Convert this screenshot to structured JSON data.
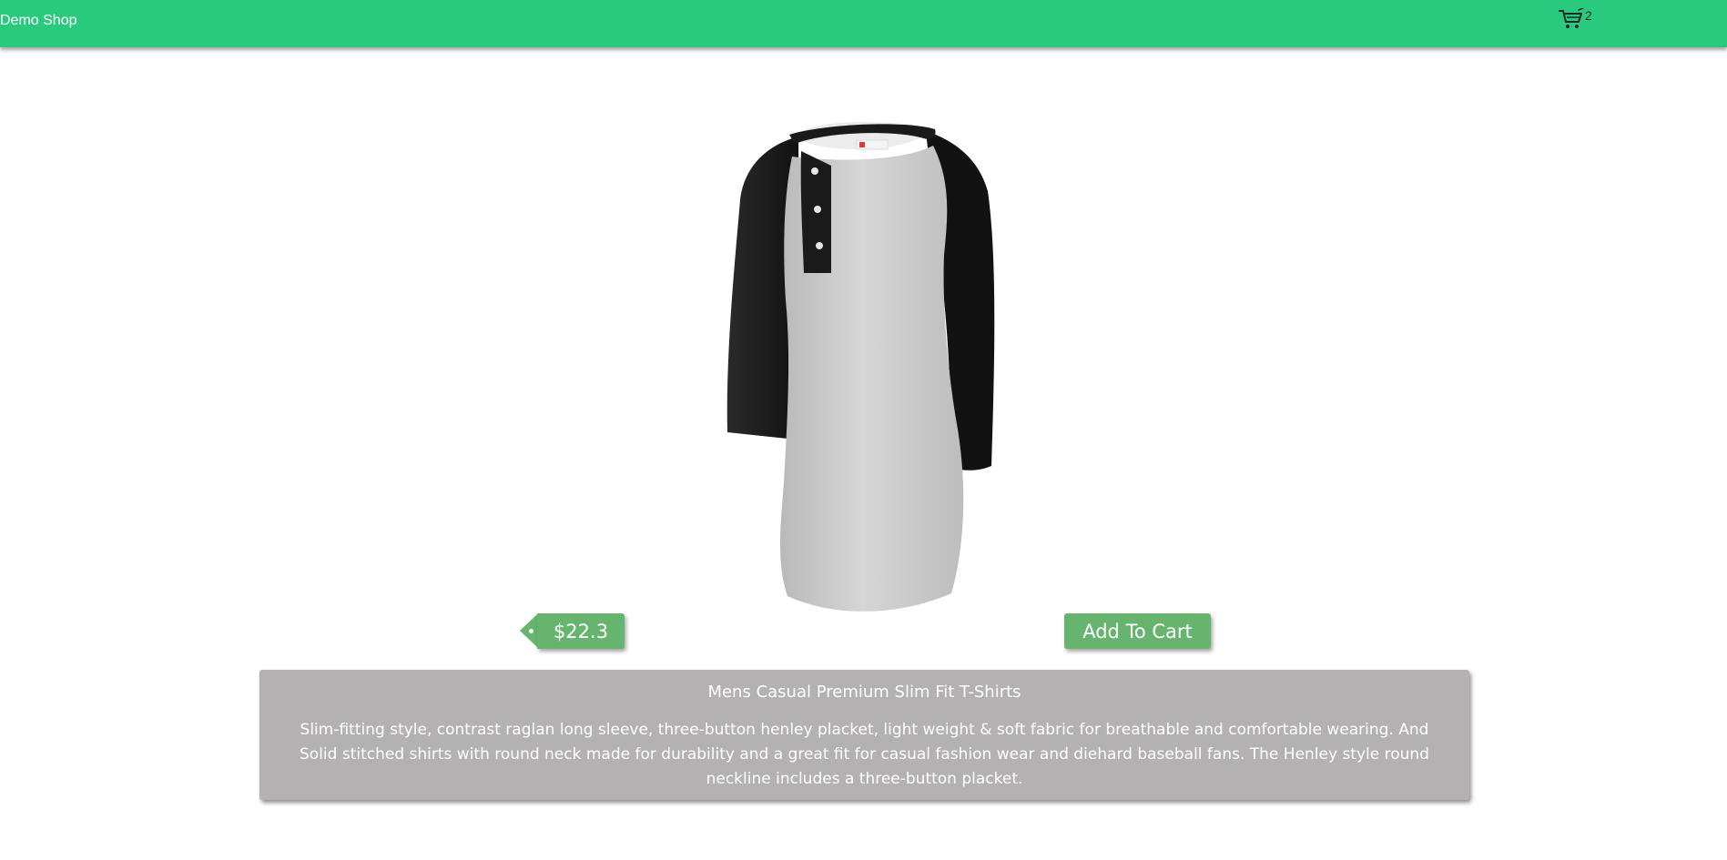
{
  "header": {
    "brand": "Demo Shop",
    "cart_icon": "shopping-cart-icon",
    "cart_count": "2",
    "color": "#29c97e"
  },
  "product": {
    "image": "raglan-henley-tshirt-image",
    "price": "$22.3",
    "add_to_cart_label": "Add To Cart",
    "title": "Mens Casual Premium Slim Fit T-Shirts",
    "description": "Slim-fitting style, contrast raglan long sleeve, three-button henley placket, light weight & soft fabric for breathable and comfortable wearing. And Solid stitched shirts with round neck made for durability and a great fit for casual fashion wear and diehard baseball fans. The Henley style round neckline includes a three-button placket.",
    "accent_color": "#66b46e",
    "card_color": "#b3b1b2"
  }
}
